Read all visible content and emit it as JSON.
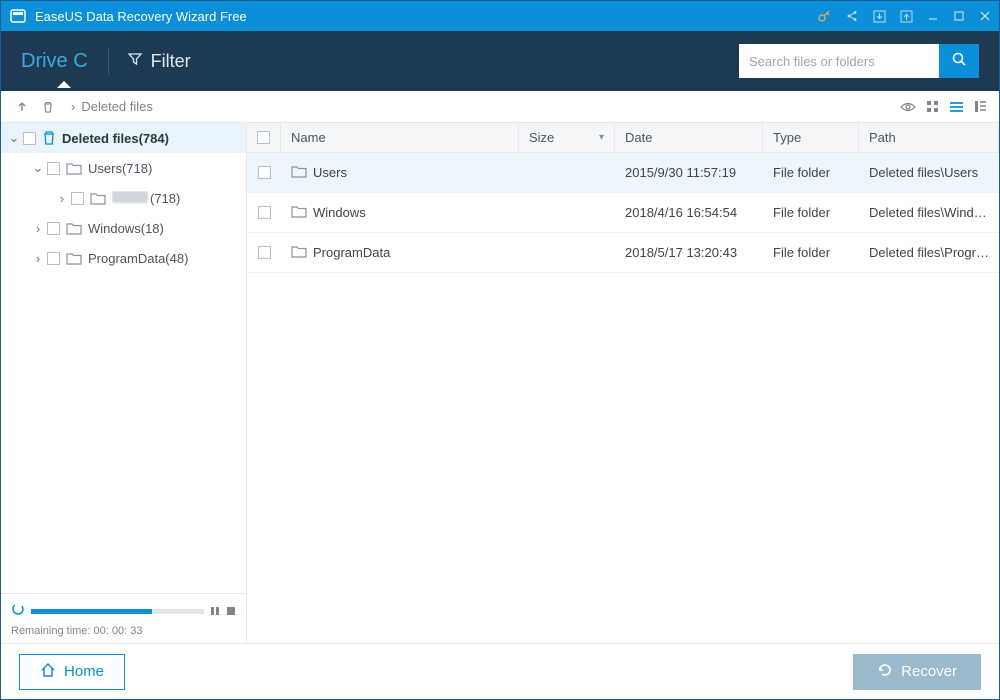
{
  "title": "EaseUS Data Recovery Wizard Free",
  "toolbar": {
    "drive_label": "Drive C",
    "filter_label": "Filter",
    "search_placeholder": "Search files or folders"
  },
  "breadcrumb": {
    "path": "Deleted files"
  },
  "tree": {
    "items": [
      {
        "label": "Deleted files(784)",
        "indent": 0,
        "expanded": true,
        "bold": true,
        "icon": "trash",
        "selected": true
      },
      {
        "label": "Users(718)",
        "indent": 1,
        "expanded": true,
        "icon": "folder"
      },
      {
        "label": "(718)",
        "indent": 2,
        "expanded": false,
        "icon": "folder",
        "blurred": true
      },
      {
        "label": "Windows(18)",
        "indent": 1,
        "expanded": false,
        "icon": "folder"
      },
      {
        "label": "ProgramData(48)",
        "indent": 1,
        "expanded": false,
        "icon": "folder"
      }
    ],
    "remaining_label": "Remaining time: 00: 00: 33",
    "progress_pct": 70
  },
  "columns": {
    "name": "Name",
    "size": "Size",
    "date": "Date",
    "type": "Type",
    "path": "Path"
  },
  "rows": [
    {
      "name": "Users",
      "size": "",
      "date": "2015/9/30 11:57:19",
      "type": "File folder",
      "path": "Deleted files\\Users",
      "hl": true
    },
    {
      "name": "Windows",
      "size": "",
      "date": "2018/4/16 16:54:54",
      "type": "File folder",
      "path": "Deleted files\\Windo..."
    },
    {
      "name": "ProgramData",
      "size": "",
      "date": "2018/5/17 13:20:43",
      "type": "File folder",
      "path": "Deleted files\\Progra..."
    }
  ],
  "bottom": {
    "home_label": "Home",
    "recover_label": "Recover"
  }
}
